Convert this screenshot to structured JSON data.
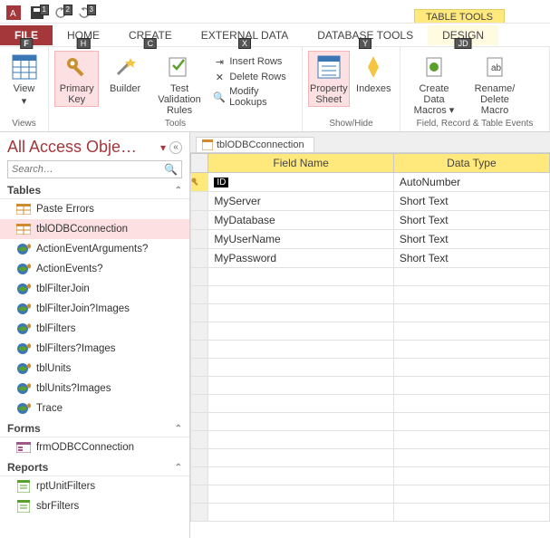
{
  "qat_keytips": [
    "1",
    "2",
    "3"
  ],
  "tool_context": "TABLE TOOLS",
  "tabs": {
    "file": "FILE",
    "home": "HOME",
    "create": "CREATE",
    "external": "EXTERNAL DATA",
    "dbtools": "DATABASE TOOLS",
    "design": "DESIGN"
  },
  "keytips": {
    "file": "F",
    "home": "H",
    "create": "C",
    "external": "X",
    "dbtools": "Y",
    "design": "JD"
  },
  "ribbon": {
    "views": {
      "view": "View",
      "group": "Views"
    },
    "tools": {
      "primary_key": "Primary Key",
      "builder": "Builder",
      "test_validation": "Test Validation Rules",
      "insert_rows": "Insert Rows",
      "delete_rows": "Delete Rows",
      "modify_lookups": "Modify Lookups",
      "group": "Tools"
    },
    "showhide": {
      "property_sheet": "Property Sheet",
      "indexes": "Indexes",
      "group": "Show/Hide"
    },
    "events": {
      "create_macros": "Create Data Macros ▾",
      "rename_delete": "Rename/ Delete Macro",
      "group": "Field, Record & Table Events"
    }
  },
  "nav": {
    "title": "All Access Obje…",
    "search_placeholder": "Search…",
    "cats": {
      "tables": "Tables",
      "forms": "Forms",
      "reports": "Reports"
    },
    "tables": [
      {
        "label": "Paste Errors",
        "type": "table"
      },
      {
        "label": "tblODBCconnection",
        "type": "table",
        "selected": true
      },
      {
        "label": "ActionEventArguments?",
        "type": "linked"
      },
      {
        "label": "ActionEvents?",
        "type": "linked"
      },
      {
        "label": "tblFilterJoin",
        "type": "linked"
      },
      {
        "label": "tblFilterJoin?Images",
        "type": "linked"
      },
      {
        "label": "tblFilters",
        "type": "linked"
      },
      {
        "label": "tblFilters?Images",
        "type": "linked"
      },
      {
        "label": "tblUnits",
        "type": "linked"
      },
      {
        "label": "tblUnits?Images",
        "type": "linked"
      },
      {
        "label": "Trace",
        "type": "linked"
      }
    ],
    "forms": [
      {
        "label": "frmODBCConnection",
        "type": "form"
      }
    ],
    "reports": [
      {
        "label": "rptUnitFilters",
        "type": "report"
      },
      {
        "label": "sbrFilters",
        "type": "report"
      }
    ]
  },
  "doc_tab": "tblODBCconnection",
  "grid": {
    "headers": {
      "field_name": "Field Name",
      "data_type": "Data Type"
    },
    "rows": [
      {
        "pk": true,
        "field": "ID",
        "type": "AutoNumber"
      },
      {
        "field": "MyServer",
        "type": "Short Text"
      },
      {
        "field": "MyDatabase",
        "type": "Short Text"
      },
      {
        "field": "MyUserName",
        "type": "Short Text"
      },
      {
        "field": "MyPassword",
        "type": "Short Text"
      }
    ],
    "blank_rows": 14
  }
}
